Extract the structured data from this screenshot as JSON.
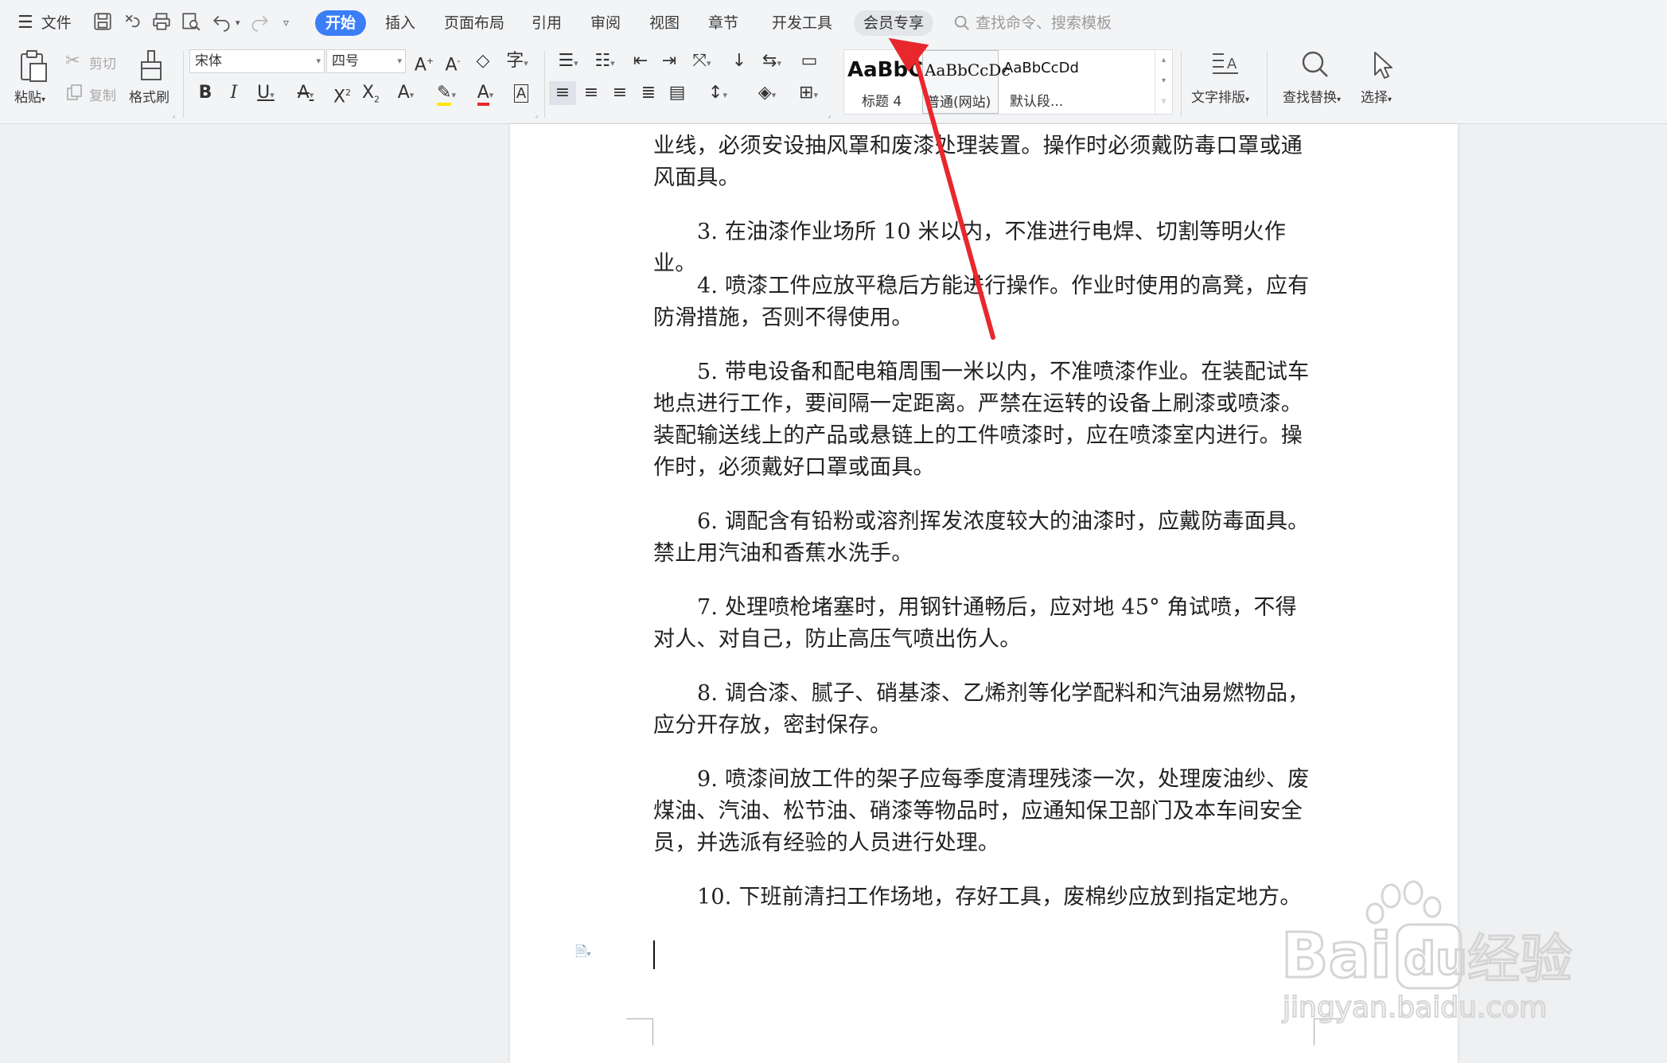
{
  "menu": {
    "file": "文件",
    "tabs": {
      "start": "开始",
      "insert": "插入",
      "layout": "页面布局",
      "references": "引用",
      "review": "审阅",
      "view": "视图",
      "section": "章节",
      "devtools": "开发工具",
      "member": "会员专享"
    },
    "search_placeholder": "查找命令、搜索模板"
  },
  "ribbon": {
    "paste": "粘贴",
    "cut": "剪切",
    "copy": "复制",
    "format_painter": "格式刷",
    "font_name": "宋体",
    "font_size": "四号",
    "styles": {
      "heading4_sample": "AaBbC",
      "heading4_name": "标题 4",
      "normal_web_sample": "AaBbCcDc",
      "normal_web_name": "普通(网站)",
      "default_sample": "AaBbCcDd",
      "default_name": "默认段..."
    },
    "text_layout": "文字排版",
    "find_replace": "查找替换",
    "select": "选择"
  },
  "document": {
    "paragraphs": [
      "业线，必须安设抽风罩和废漆处理装置。操作时必须戴防毒口罩或通风面具。",
      "3. 在油漆作业场所 10 米以内，不准进行电焊、切割等明火作业。",
      "4. 喷漆工件应放平稳后方能进行操作。作业时使用的高凳，应有防滑措施，否则不得使用。",
      "5. 带电设备和配电箱周围一米以内，不准喷漆作业。在装配试车地点进行工作，要间隔一定距离。严禁在运转的设备上刷漆或喷漆。装配输送线上的产品或悬链上的工件喷漆时，应在喷漆室内进行。操作时，必须戴好口罩或面具。",
      "6. 调配含有铅粉或溶剂挥发浓度较大的油漆时，应戴防毒面具。禁止用汽油和香蕉水洗手。",
      "7. 处理喷枪堵塞时，用钢针通畅后，应对地 45° 角试喷，不得对人、对自己，防止高压气喷出伤人。",
      "8. 调合漆、腻子、硝基漆、乙烯剂等化学配料和汽油易燃物品，应分开存放，密封保存。",
      "9. 喷漆间放工件的架子应每季度清理残漆一次，处理废油纱、废煤油、汽油、松节油、硝漆等物品时，应通知保卫部门及本车间安全员，并选派有经验的人员进行处理。",
      "10. 下班前清扫工作场地，存好工具，废棉纱应放到指定地方。"
    ]
  },
  "watermark": {
    "brand": "Bai",
    "brand2": "du",
    "cn": "经验",
    "url": "jingyan.baidu.com"
  },
  "colors": {
    "accent": "#3b7ef6",
    "arrow": "#e8282c"
  }
}
